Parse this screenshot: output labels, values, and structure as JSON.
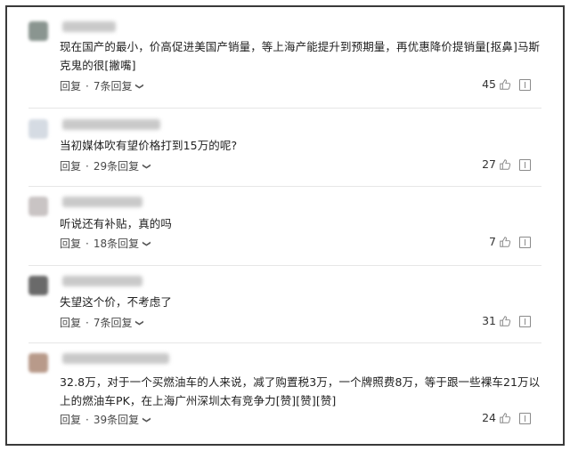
{
  "comments": [
    {
      "text": "现在国产的最小，价高促进美国产销量，等上海产能提升到预期量，再优惠降价提销量[抠鼻]马斯克鬼的很[撇嘴]",
      "reply_label": "回复",
      "reply_count": "7条回复",
      "likes": "45",
      "avatar_color": "#8a9590"
    },
    {
      "text": "当初媒体吹有望价格打到15万的呢?",
      "reply_label": "回复",
      "reply_count": "29条回复",
      "likes": "27",
      "avatar_color": "#d5dbe3"
    },
    {
      "text": "听说还有补贴，真的吗",
      "reply_label": "回复",
      "reply_count": "18条回复",
      "likes": "7",
      "avatar_color": "#c9c4c4"
    },
    {
      "text": "失望这个价，不考虑了",
      "reply_label": "回复",
      "reply_count": "7条回复",
      "likes": "31",
      "avatar_color": "#6a6a6a"
    },
    {
      "text": "32.8万，对于一个买燃油车的人来说，减了购置税3万，一个牌照费8万，等于跟一些裸车21万以上的燃油车PK，在上海广州深圳太有竞争力[赞][赞][赞]",
      "reply_label": "回复",
      "reply_count": "39条回复",
      "likes": "24",
      "avatar_color": "#b89a8a"
    }
  ],
  "icons": {
    "like": "thumbs-up-icon",
    "report": "report-icon",
    "expand": "chevron-down-icon"
  }
}
